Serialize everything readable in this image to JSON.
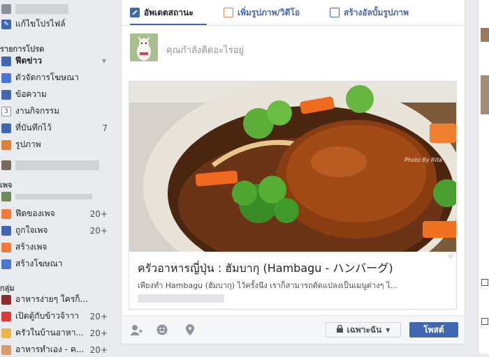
{
  "sidebar": {
    "edit_profile": "แก้ไขโปรไฟล์",
    "favorites_header": "รายการโปรด",
    "favorites": [
      {
        "label": "ฟีดข่าว",
        "icon": "news-feed-icon",
        "count": "",
        "color": "#4267b2"
      },
      {
        "label": "ตัวจัดการโฆษณา",
        "icon": "ads-manager-icon",
        "count": "",
        "color": "#4a77d4"
      },
      {
        "label": "ข้อความ",
        "icon": "messages-icon",
        "count": "",
        "color": "#4267b2"
      },
      {
        "label": "งานกิจกรรม",
        "icon": "events-icon",
        "count": "",
        "color": "#ffffff"
      },
      {
        "label": "ที่บันทึกไว้",
        "icon": "saved-icon",
        "count": "7",
        "color": "#4267b2"
      },
      {
        "label": "รูปภาพ",
        "icon": "photos-icon",
        "count": "",
        "color": "#e0803a"
      }
    ],
    "pages_header": "เพจ",
    "pages": [
      {
        "label": "ฟีดของเพจ",
        "icon": "pages-feed-icon",
        "count": "20+",
        "color": "#f5793b"
      },
      {
        "label": "ถูกใจเพจ",
        "icon": "like-pages-icon",
        "count": "20+",
        "color": "#4267b2"
      },
      {
        "label": "สร้างเพจ",
        "icon": "create-page-icon",
        "count": "",
        "color": "#f5793b"
      },
      {
        "label": "สร้างโฆษณา",
        "icon": "create-ad-icon",
        "count": "",
        "color": "#4a77d4"
      }
    ],
    "groups_header": "กลุ่ม",
    "groups": [
      {
        "label": "อาหารง่ายๆ ใครก็...",
        "icon": "group-wine-icon",
        "count": "",
        "color": "#8b2d2d"
      },
      {
        "label": "เปิดตู้กับข้าวจ้าาา",
        "icon": "group-apple-icon",
        "count": "20+",
        "color": "#d93b3b"
      },
      {
        "label": "ครัวในบ้านอาหา...",
        "icon": "group-house-icon",
        "count": "20+",
        "color": "#e6b84a"
      },
      {
        "label": "อาหารทำเอง - ค...",
        "icon": "group-hand-icon",
        "count": "20+",
        "color": "#d99a6c"
      }
    ]
  },
  "composer": {
    "tabs": [
      {
        "label": "อัพเดตสถานะ"
      },
      {
        "label": "เพิ่มรูปภาพ/วิดีโอ"
      },
      {
        "label": "สร้างอัลบั้มรูปภาพ"
      }
    ],
    "placeholder": "คุณกำลังคิดอะไรอยู่",
    "link_title": "ครัวอาหารญี่ปุ่น : ฮัมบากุ (Hambagu - ハンバーグ)",
    "link_description": "เพียงทำ Hambagu (ฮัมบากุ) ไว้ครั้งนึง เราก็สามารถดัดแปลงเป็นเมนูต่างๆ ไ...",
    "photo_credit": "Photo By Rita",
    "privacy_label": "เฉพาะฉัน",
    "post_label": "โพสต์"
  }
}
